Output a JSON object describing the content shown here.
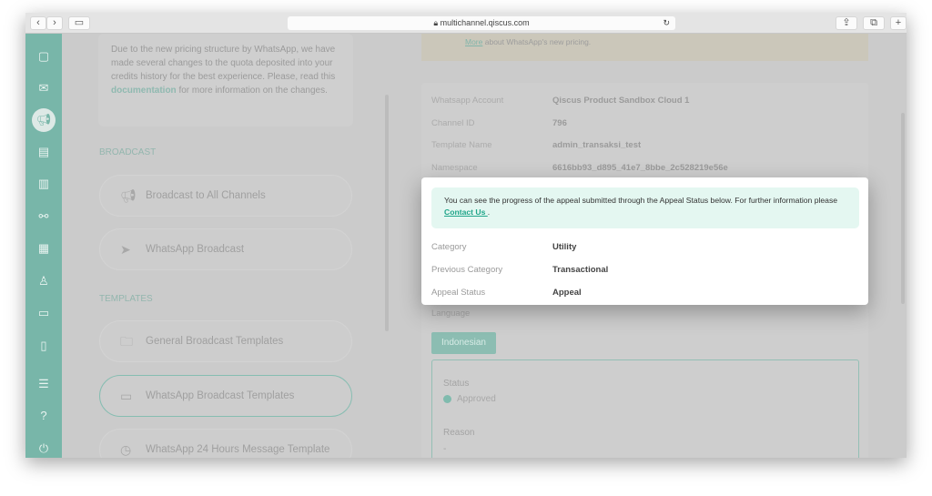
{
  "browser": {
    "url": "multichannel.qiscus.com",
    "back": "‹",
    "forward": "›"
  },
  "sidebar": {
    "icons": [
      "chat-icon",
      "mail-icon",
      "megaphone-icon",
      "contact-card-icon",
      "analytics-icon",
      "integration-icon",
      "apps-icon",
      "user-icon",
      "ticket-icon",
      "mobile-icon",
      "settings-sliders-icon",
      "help-icon",
      "power-icon"
    ]
  },
  "notice": {
    "text_before": "Due to the new pricing structure by WhatsApp, we have made several changes to the quota deposited into your credits history for the best experience. Please, read this ",
    "link": "documentation",
    "text_after": " for more information on the changes."
  },
  "broadcast": {
    "heading": "BROADCAST",
    "items": [
      "Broadcast to All Channels",
      "WhatsApp Broadcast"
    ]
  },
  "templates": {
    "heading": "TEMPLATES",
    "items": [
      "General Broadcast Templates",
      "WhatsApp Broadcast Templates",
      "WhatsApp 24 Hours Message Template"
    ]
  },
  "banner": {
    "link": "More",
    "text": " about WhatsApp's new pricing."
  },
  "details": [
    {
      "label": "Whatsapp Account",
      "value": "Qiscus Product Sandbox Cloud 1"
    },
    {
      "label": "Channel ID",
      "value": "796"
    },
    {
      "label": "Template Name",
      "value": "admin_transaksi_test"
    },
    {
      "label": "Namespace",
      "value": "6616bb93_d895_41e7_8bbe_2c528219e56e"
    }
  ],
  "language": {
    "label": "Language",
    "selected": "Indonesian"
  },
  "status": {
    "label": "Status",
    "value": "Approved",
    "reason_label": "Reason",
    "reason_value": "-"
  },
  "modal": {
    "note_before": "You can see the progress of the appeal submitted through the Appeal Status below. For further information please ",
    "note_link": "Contact Us ",
    "note_after": ".",
    "rows": [
      {
        "label": "Category",
        "value": "Utility"
      },
      {
        "label": "Previous Category",
        "value": "Transactional"
      },
      {
        "label": "Appeal Status",
        "value": "Appeal"
      }
    ]
  }
}
